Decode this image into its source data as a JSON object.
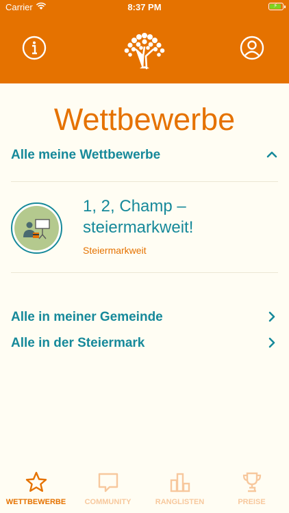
{
  "status_bar": {
    "carrier": "Carrier",
    "time": "8:37 PM"
  },
  "header": {
    "title": "Wettbewerbe"
  },
  "my_competitions": {
    "header": "Alle meine Wettbewerbe",
    "items": [
      {
        "title": "1, 2, Champ – steiermarkweit!",
        "subtitle": "Steiermarkweit"
      }
    ]
  },
  "links": [
    {
      "label": "Alle in meiner Gemeinde"
    },
    {
      "label": "Alle in der Steiermark"
    }
  ],
  "tabs": [
    {
      "label": "WETTBEWERBE",
      "icon": "star-icon",
      "active": true
    },
    {
      "label": "COMMUNITY",
      "icon": "speech-bubble-icon",
      "active": false
    },
    {
      "label": "RANGLISTEN",
      "icon": "bar-chart-icon",
      "active": false
    },
    {
      "label": "PREISE",
      "icon": "trophy-icon",
      "active": false
    }
  ],
  "colors": {
    "brand": "#e57200",
    "teal": "#16899a",
    "background": "#fffdf3",
    "inactive_tab": "#f7c89d"
  }
}
